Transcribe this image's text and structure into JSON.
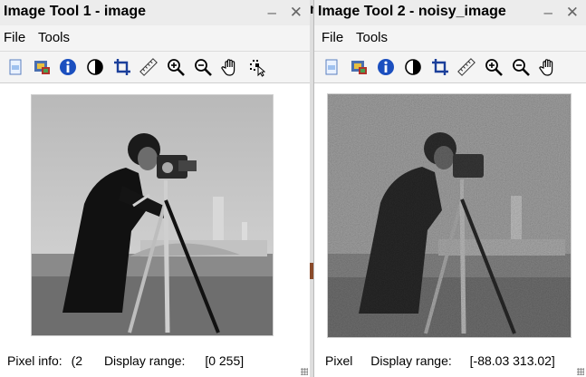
{
  "window1": {
    "title": "Image Tool 1 - image",
    "menu": [
      "File",
      "Tools"
    ],
    "status": {
      "pixel_info_label": "Pixel info:",
      "pixel_info_value": "(2",
      "display_range_label": "Display range:",
      "display_range_value": "[0 255]"
    }
  },
  "window2": {
    "title": "Image Tool 2 - noisy_image",
    "menu": [
      "File",
      "Tools"
    ],
    "status": {
      "pixel_info_label": "Pixel",
      "display_range_label": "Display range:",
      "display_range_value": "[-88.03 313.02]"
    }
  },
  "titlebar_buttons": {
    "minimize": "–",
    "close": "✕"
  },
  "background_fragment": "n",
  "toolbar_icons": [
    "new-figure-icon",
    "image-overview-icon",
    "info-icon",
    "contrast-icon",
    "crop-icon",
    "measure-ruler-icon",
    "zoom-in-icon",
    "zoom-out-icon",
    "pan-hand-icon",
    "pixel-region-icon"
  ],
  "colors": {
    "info_blue": "#1b4fbf",
    "crop_blue": "#1b3f9a",
    "titlebar": "#ececec"
  }
}
